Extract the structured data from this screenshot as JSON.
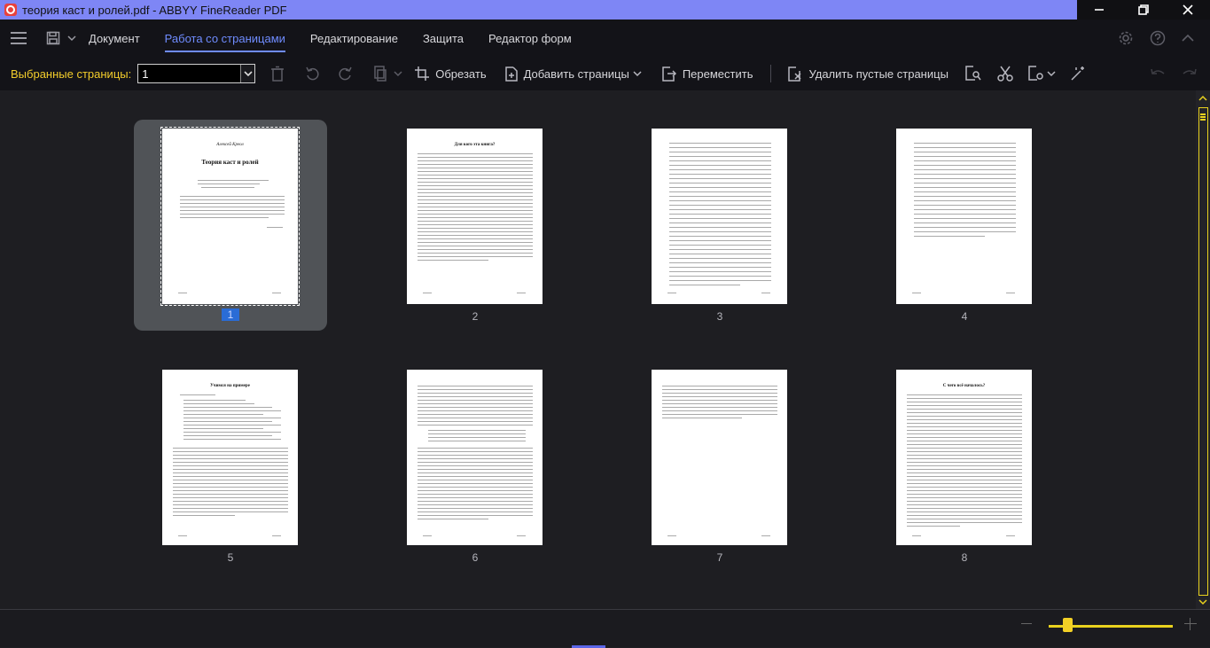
{
  "window": {
    "title": "теория каст и ролей.pdf - ABBYY FineReader PDF"
  },
  "menu": {
    "tabs": [
      {
        "label": "Документ"
      },
      {
        "label": "Работа со страницами"
      },
      {
        "label": "Редактирование"
      },
      {
        "label": "Защита"
      },
      {
        "label": "Редактор форм"
      }
    ],
    "active_tab": "Работа со страницами"
  },
  "toolbar": {
    "selected_pages_label": "Выбранные страницы:",
    "selected_pages_value": "1",
    "crop_label": "Обрезать",
    "add_pages_label": "Добавить страницы",
    "move_label": "Переместить",
    "delete_blank_label": "Удалить пустые страницы"
  },
  "pages": [
    {
      "number": "1",
      "selected": true,
      "author": "Алексей Креол",
      "title": "Теория каст и ролей"
    },
    {
      "number": "2",
      "selected": false,
      "title": "Для кого эта книга?"
    },
    {
      "number": "3",
      "selected": false
    },
    {
      "number": "4",
      "selected": false
    },
    {
      "number": "5",
      "selected": false,
      "title": "Учимся на примере"
    },
    {
      "number": "6",
      "selected": false
    },
    {
      "number": "7",
      "selected": false
    },
    {
      "number": "8",
      "selected": false,
      "title": "С чего всё началось?"
    }
  ],
  "colors": {
    "title_bar": "#7e86f5",
    "accent": "#6f8cff",
    "highlight": "#f3cd2b",
    "selection": "#2a6cd6"
  },
  "zoom": {
    "level_fraction": 0.16
  }
}
